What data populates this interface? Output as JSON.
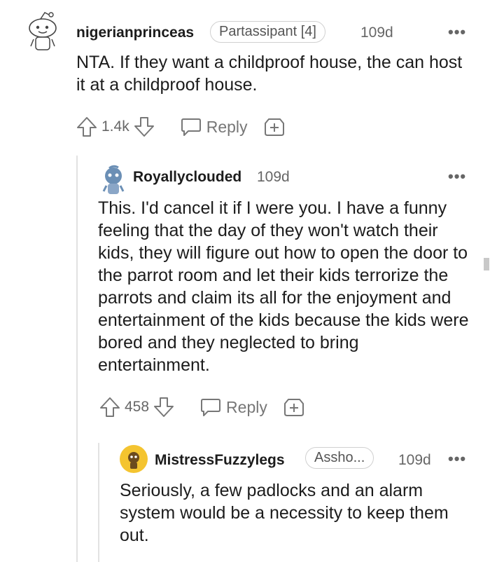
{
  "comments": [
    {
      "username": "nigerianprinceas",
      "flair": "Partassipant [4]",
      "age": "109d",
      "more": "•••",
      "text": "NTA. If they want a childproof house, the can host it at a childproof house.",
      "votes": "1.4k",
      "reply_label": "Reply"
    },
    {
      "username": "Royallyclouded",
      "age": "109d",
      "more": "•••",
      "text": "This. I'd cancel it if I were you. I have a funny feeling that the day of they won't watch their kids, they will figure out how to open the door to the parrot room and let their kids terrorize the parrots and claim its all for the enjoyment and entertainment of the kids because the kids were bored and they neglected to bring entertainment.",
      "votes": "458",
      "reply_label": "Reply"
    },
    {
      "username": "MistressFuzzylegs",
      "flair": "Assho...",
      "age": "109d",
      "more": "•••",
      "text": "Seriously, a few padlocks and an alarm system would be a necessity to keep them out."
    }
  ],
  "colors": {
    "text": "#1c1c1c",
    "muted": "#777777",
    "thread_line": "#e2e2e2",
    "avatar_blue": "#6b8fb5",
    "avatar_yellow": "#f4c430"
  }
}
